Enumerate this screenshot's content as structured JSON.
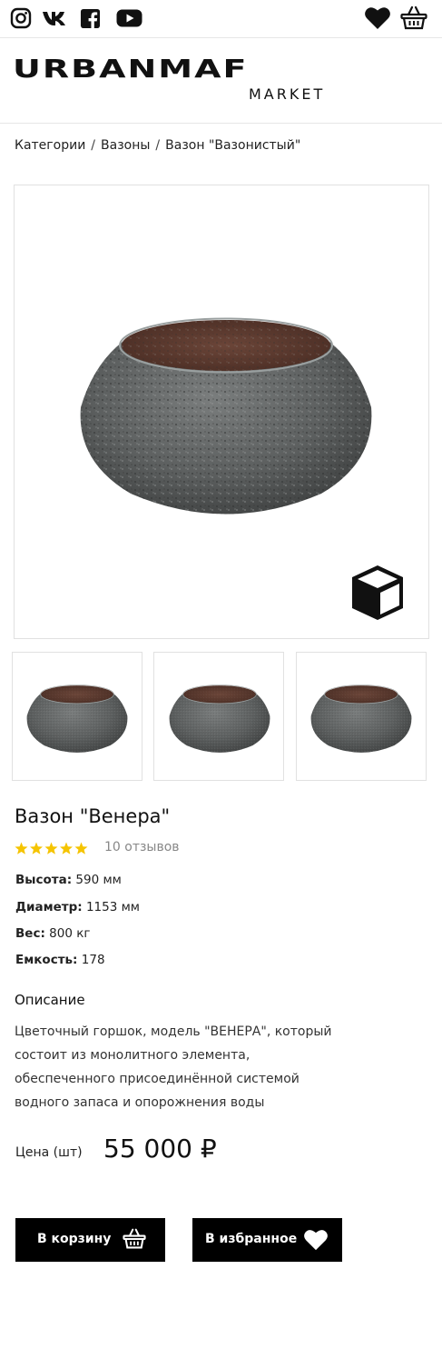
{
  "header": {
    "social_icons": [
      "instagram-icon",
      "vk-icon",
      "facebook-icon",
      "youtube-icon"
    ],
    "action_icons": [
      "heart-icon",
      "basket-icon"
    ]
  },
  "logo": {
    "main": "URBANMAF",
    "sub": "MARKET"
  },
  "breadcrumb": [
    "Категории",
    "Вазоны",
    "Вазон \"Вазонистый\""
  ],
  "gallery": {
    "main_alt_icon": "3d-cube-icon",
    "thumbnail_count": 3
  },
  "product": {
    "title": "Вазон \"Венера\"",
    "rating": 5,
    "reviews": "10 отзывов",
    "specs": [
      {
        "label": "Высота:",
        "value": "590 мм"
      },
      {
        "label": "Диаметр:",
        "value": "1153 мм"
      },
      {
        "label": "Вес:",
        "value": "800 кг"
      },
      {
        "label": "Емкость:",
        "value": "178"
      }
    ],
    "description_title": "Описание",
    "description": "Цветочный горшок, модель \"ВЕНЕРА\", который состоит из монолитного элемента, обеспеченного присоединённой системой водного запаса и опорожнения воды",
    "price_label": "Цена (шт)",
    "price": "55 000 ₽"
  },
  "buttons": {
    "cart": "В корзину",
    "favorite": "В избранное"
  },
  "colors": {
    "button_bg": "#000000",
    "star": "#f5c400"
  }
}
